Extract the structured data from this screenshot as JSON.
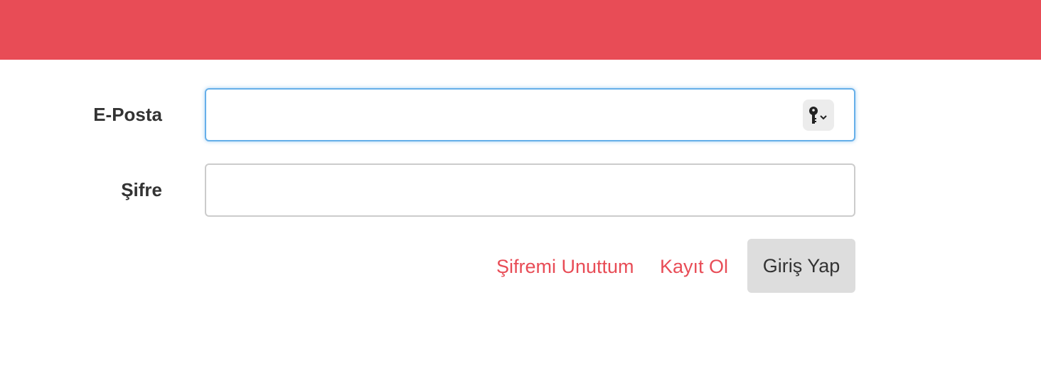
{
  "colors": {
    "header_bar": "#e84c56",
    "link": "#e84c56",
    "focus_border": "#66afe9",
    "button_bg": "#dddddd"
  },
  "form": {
    "email_label": "E-Posta",
    "email_value": "",
    "email_icon": "key-dropdown-icon",
    "password_label": "Şifre",
    "password_value": ""
  },
  "actions": {
    "forgot_password": "Şifremi Unuttum",
    "register": "Kayıt Ol",
    "login": "Giriş Yap"
  }
}
